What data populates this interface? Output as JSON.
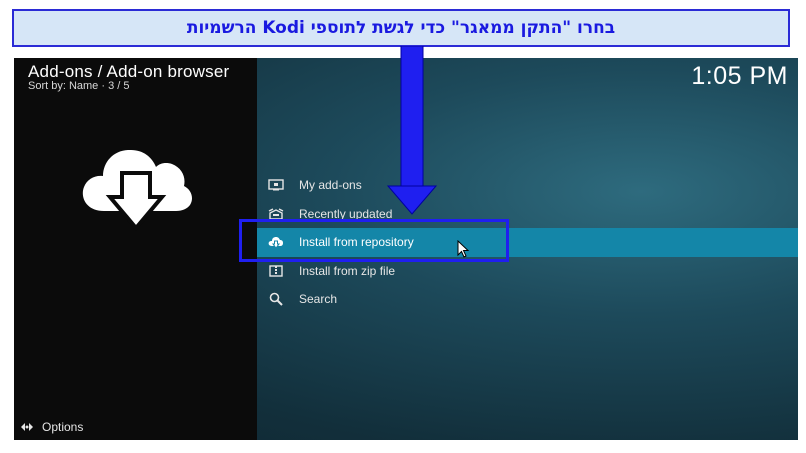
{
  "banner": {
    "text": "בחרו \"התקן ממאגר\" כדי לגשת לתוספי Kodi הרשמיות"
  },
  "header": {
    "title": "Add-ons / Add-on browser",
    "subtitle": "Sort by: Name  ·  3 / 5",
    "clock": "1:05 PM"
  },
  "menu": {
    "items": [
      {
        "label": "My add-ons",
        "icon": "monitor-box-icon"
      },
      {
        "label": "Recently updated",
        "icon": "open-box-icon"
      },
      {
        "label": "Install from repository",
        "icon": "cloud-download-icon",
        "selected": true
      },
      {
        "label": "Install from zip file",
        "icon": "zip-box-icon"
      },
      {
        "label": "Search",
        "icon": "magnifier-icon"
      }
    ]
  },
  "footer": {
    "options_label": "Options"
  },
  "colors": {
    "banner_bg": "#d6e6f7",
    "annotation_blue": "#1f1ff0",
    "selected_item": "#1486a8",
    "left_panel": "#0b0b0b"
  }
}
